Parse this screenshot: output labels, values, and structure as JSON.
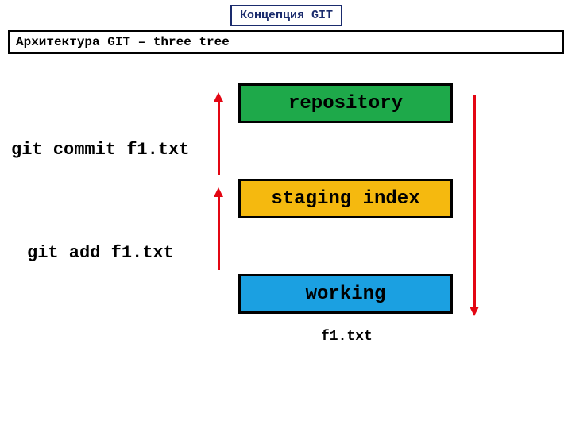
{
  "header": {
    "title": "Концепция GIT",
    "subtitle": "Архитектура GIT – three tree"
  },
  "trees": {
    "repository": "repository",
    "staging": "staging index",
    "working": "working"
  },
  "commands": {
    "commit": "git commit f1.txt",
    "add": "git add f1.txt"
  },
  "file": "f1.txt",
  "colors": {
    "repository": "#1ea94a",
    "staging": "#f5b90f",
    "working": "#1ba0e1",
    "arrow": "#e30613",
    "title_border": "#1a2b6d"
  }
}
